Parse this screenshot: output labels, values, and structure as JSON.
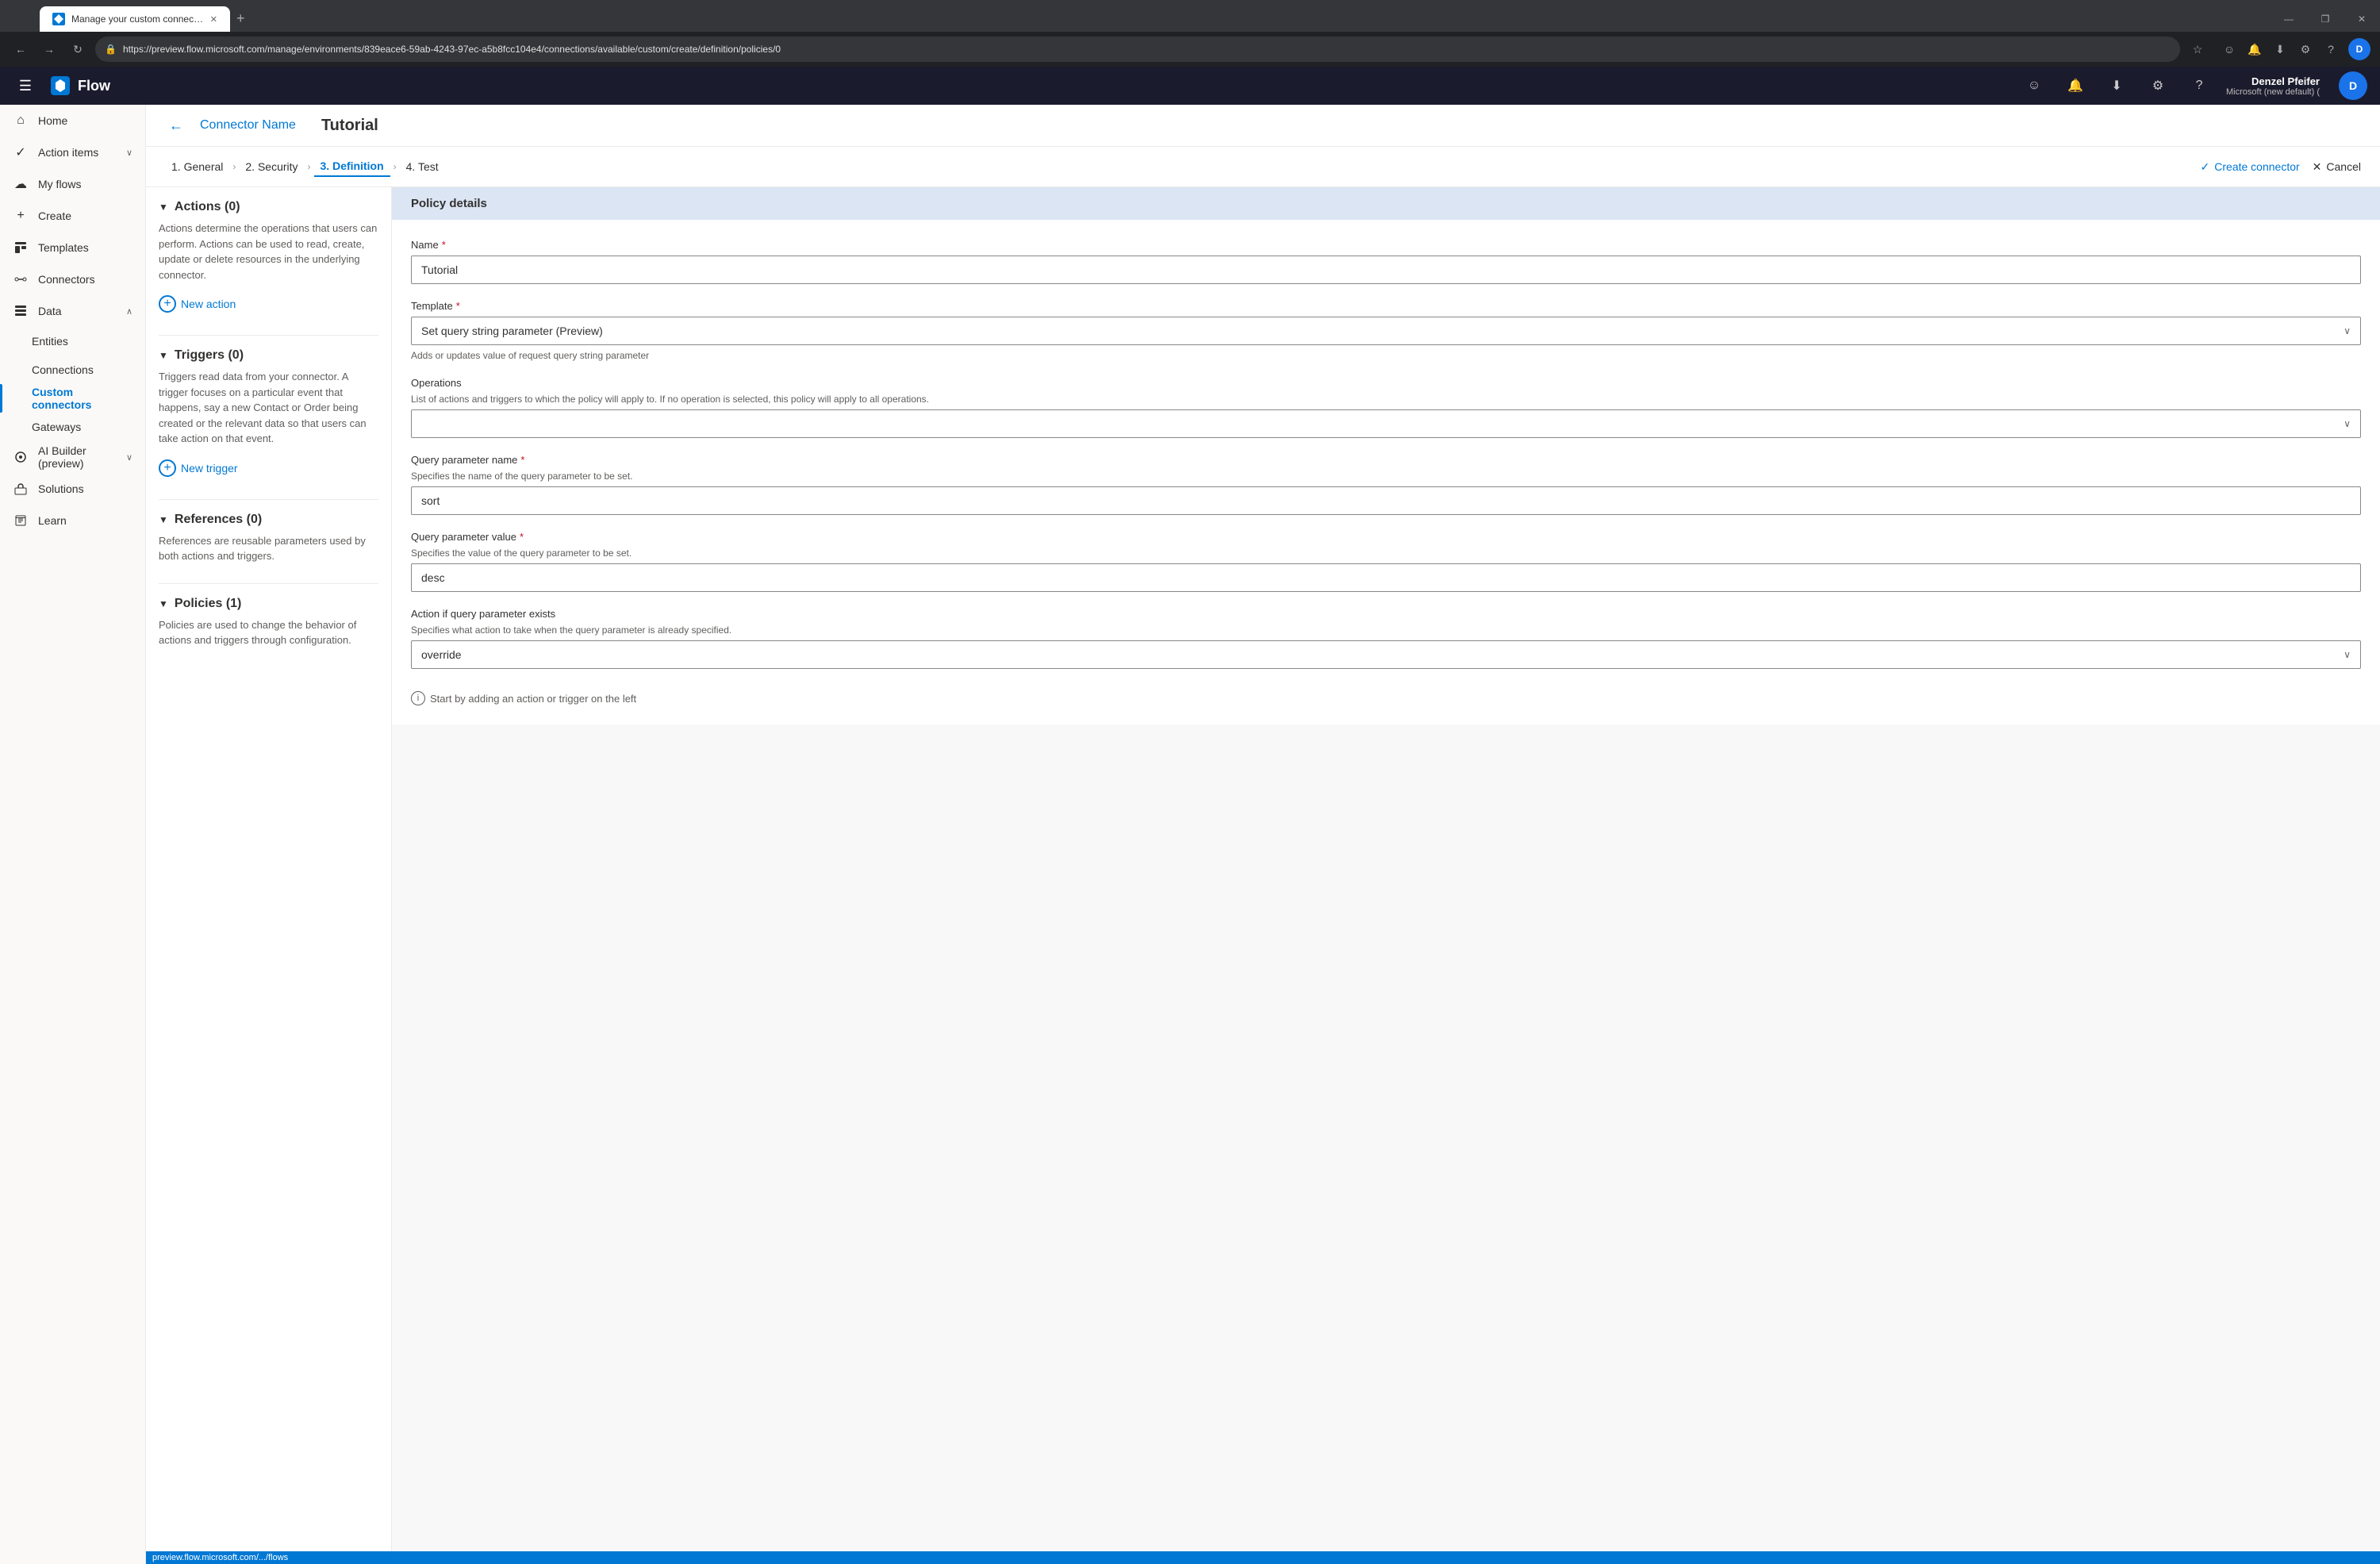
{
  "browser": {
    "tab_title": "Manage your custom connectors",
    "tab_favicon_text": "F",
    "new_tab_label": "+",
    "address": "https://preview.flow.microsoft.com/manage/environments/839eace6-59ab-4243-97ec-a5b8fcc104e4/connections/available/custom/create/definition/policies/0",
    "status_bar_text": "preview.flow.microsoft.com/.../flows",
    "window_controls": {
      "minimize": "—",
      "maximize": "❐",
      "close": "✕"
    },
    "nav": {
      "back": "←",
      "forward": "→",
      "refresh": "↻",
      "star": "☆"
    },
    "browser_actions": {
      "feedback": "☺",
      "alerts": "🔔",
      "download": "⬇",
      "settings": "⚙",
      "help": "?"
    },
    "user": {
      "name": "Denzel Pfeifer",
      "org": "Microsoft (new default) (",
      "avatar_text": "D"
    }
  },
  "top_nav": {
    "app_name": "Flow",
    "icons": [
      "☺",
      "🔔",
      "⬇",
      "⚙",
      "?"
    ]
  },
  "sidebar": {
    "items": [
      {
        "id": "home",
        "label": "Home",
        "icon": "⌂",
        "active": false
      },
      {
        "id": "action-items",
        "label": "Action items",
        "icon": "✓",
        "active": false,
        "has_chevron": true
      },
      {
        "id": "my-flows",
        "label": "My flows",
        "icon": "☁",
        "active": false
      },
      {
        "id": "create",
        "label": "Create",
        "icon": "+",
        "active": false
      },
      {
        "id": "templates",
        "label": "Templates",
        "icon": "📋",
        "active": false
      },
      {
        "id": "connectors",
        "label": "Connectors",
        "icon": "🔗",
        "active": false
      },
      {
        "id": "data",
        "label": "Data",
        "icon": "📊",
        "active": false,
        "has_chevron": true,
        "expanded": true
      },
      {
        "id": "entities",
        "label": "Entities",
        "icon": "",
        "active": false,
        "indent": true
      },
      {
        "id": "connections",
        "label": "Connections",
        "icon": "",
        "active": false,
        "indent": true
      },
      {
        "id": "custom-connectors",
        "label": "Custom connectors",
        "icon": "",
        "active": true,
        "indent": true
      },
      {
        "id": "gateways",
        "label": "Gateways",
        "icon": "",
        "active": false,
        "indent": true
      },
      {
        "id": "ai-builder",
        "label": "AI Builder (preview)",
        "icon": "🤖",
        "active": false,
        "has_chevron": true
      },
      {
        "id": "solutions",
        "label": "Solutions",
        "icon": "📦",
        "active": false
      },
      {
        "id": "learn",
        "label": "Learn",
        "icon": "📖",
        "active": false
      }
    ]
  },
  "page_header": {
    "back_icon": "←",
    "connector_name": "Connector Name",
    "separator": "",
    "title": "Tutorial"
  },
  "steps": [
    {
      "id": "general",
      "label": "1. General",
      "active": false
    },
    {
      "id": "security",
      "label": "2. Security",
      "active": false
    },
    {
      "id": "definition",
      "label": "3. Definition",
      "active": true
    },
    {
      "id": "test",
      "label": "4. Test",
      "active": false
    }
  ],
  "steps_actions": {
    "create_connector_label": "Create connector",
    "cancel_label": "Cancel"
  },
  "left_panel": {
    "actions_section": {
      "title": "Actions (0)",
      "description": "Actions determine the operations that users can perform. Actions can be used to read, create, update or delete resources in the underlying connector.",
      "new_action_label": "New action"
    },
    "triggers_section": {
      "title": "Triggers (0)",
      "description": "Triggers read data from your connector. A trigger focuses on a particular event that happens, say a new Contact or Order being created or the relevant data so that users can take action on that event.",
      "new_trigger_label": "New trigger"
    },
    "references_section": {
      "title": "References (0)",
      "description": "References are reusable parameters used by both actions and triggers."
    },
    "policies_section": {
      "title": "Policies (1)",
      "description": "Policies are used to change the behavior of actions and triggers through configuration."
    }
  },
  "right_panel": {
    "policy_details_title": "Policy details",
    "name_label": "Name",
    "name_required": true,
    "name_value": "Tutorial",
    "template_label": "Template",
    "template_required": true,
    "template_value": "Set query string parameter (Preview)",
    "template_hint": "Adds or updates value of request query string parameter",
    "operations_label": "Operations",
    "operations_hint": "List of actions and triggers to which the policy will apply to. If no operation is selected, this policy will apply to all operations.",
    "operations_placeholder": "",
    "query_param_name_label": "Query parameter name",
    "query_param_name_required": true,
    "query_param_name_hint": "Specifies the name of the query parameter to be set.",
    "query_param_name_value": "sort",
    "query_param_value_label": "Query parameter value",
    "query_param_value_required": true,
    "query_param_value_hint": "Specifies the value of the query parameter to be set.",
    "query_param_value_value": "desc",
    "action_if_exists_label": "Action if query parameter exists",
    "action_if_exists_hint": "Specifies what action to take when the query parameter is already specified.",
    "action_if_exists_value": "override",
    "bottom_hint": "Start by adding an action or trigger on the left"
  }
}
